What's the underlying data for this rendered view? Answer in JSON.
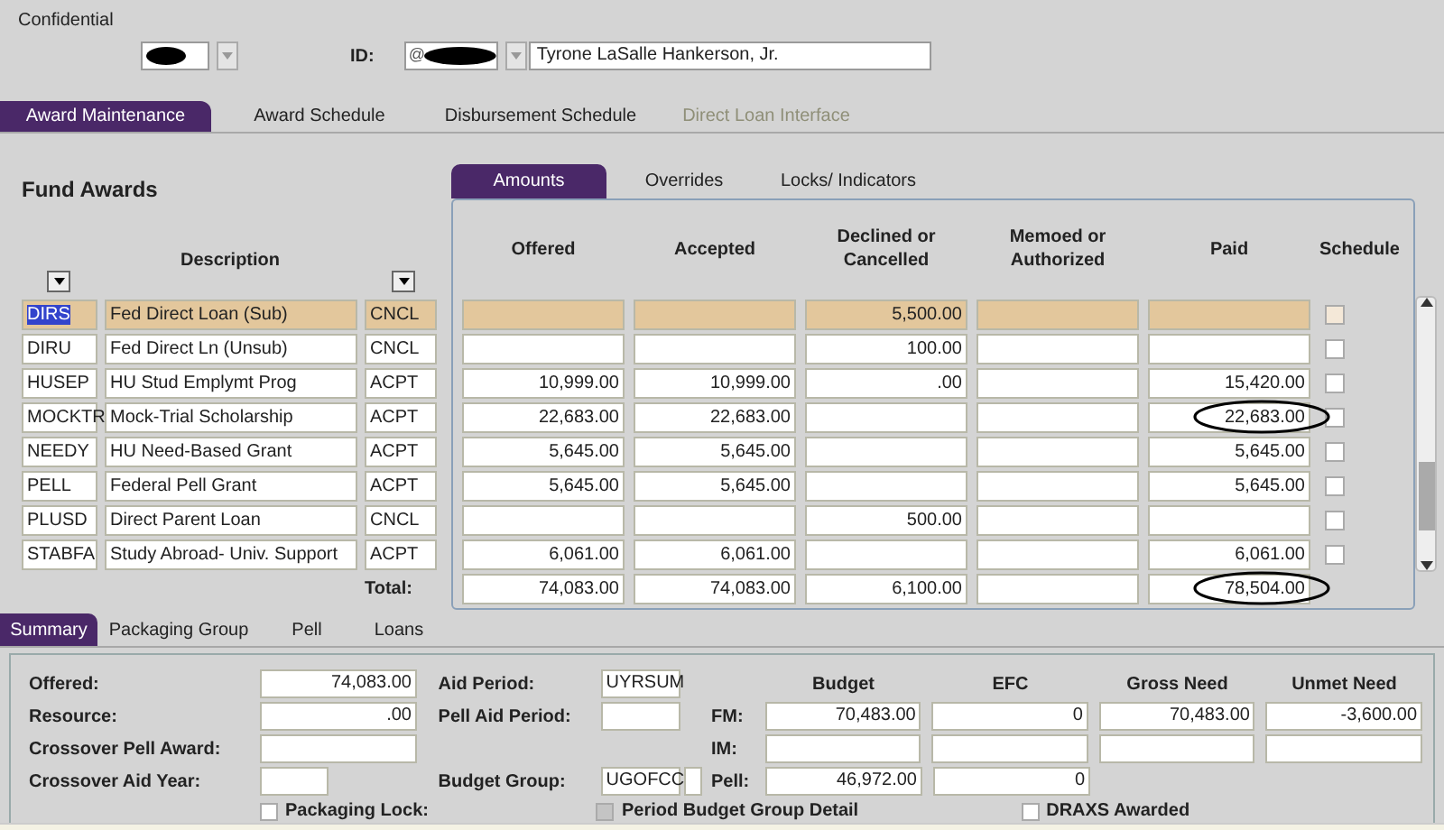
{
  "header": {
    "title": "Confidential",
    "id_label": "ID:",
    "id_prefix": "@",
    "name": "Tyrone LaSalle Hankerson, Jr."
  },
  "main_tabs": [
    {
      "label": "Award Maintenance",
      "selected": true,
      "disabled": false
    },
    {
      "label": "Award Schedule",
      "selected": false,
      "disabled": false
    },
    {
      "label": "Disbursement Schedule",
      "selected": false,
      "disabled": false
    },
    {
      "label": "Direct Loan Interface",
      "selected": false,
      "disabled": true
    }
  ],
  "fund_awards": {
    "title": "Fund Awards",
    "description_heading": "Description",
    "total_label": "Total:",
    "rows": [
      {
        "code": "DIRS",
        "description": "Fed Direct Loan (Sub)",
        "status": "CNCL",
        "declined": "5,500.00",
        "selected": true,
        "scheduled": false,
        "circled": false
      },
      {
        "code": "DIRU",
        "description": "Fed Direct Ln (Unsub)",
        "status": "CNCL",
        "declined": "100.00",
        "selected": false,
        "scheduled": false,
        "circled": false
      },
      {
        "code": "HUSEP",
        "description": "HU Stud Emplymt Prog",
        "status": "ACPT",
        "offered": "10,999.00",
        "accepted": "10,999.00",
        "declined": ".00",
        "paid": "15,420.00",
        "selected": false,
        "scheduled": false,
        "circled": false
      },
      {
        "code": "MOCKTR",
        "description": "Mock-Trial Scholarship",
        "status": "ACPT",
        "offered": "22,683.00",
        "accepted": "22,683.00",
        "paid": "22,683.00",
        "selected": false,
        "scheduled": false,
        "circled": true
      },
      {
        "code": "NEEDY",
        "description": "HU Need-Based Grant",
        "status": "ACPT",
        "offered": "5,645.00",
        "accepted": "5,645.00",
        "paid": "5,645.00",
        "selected": false,
        "scheduled": false,
        "circled": false
      },
      {
        "code": "PELL",
        "description": "Federal Pell Grant",
        "status": "ACPT",
        "offered": "5,645.00",
        "accepted": "5,645.00",
        "paid": "5,645.00",
        "selected": false,
        "scheduled": false,
        "circled": false
      },
      {
        "code": "PLUSD",
        "description": "Direct Parent Loan",
        "status": "CNCL",
        "declined": "500.00",
        "selected": false,
        "scheduled": false,
        "circled": false
      },
      {
        "code": "STABFA",
        "description": "Study Abroad- Univ. Support",
        "status": "ACPT",
        "offered": "6,061.00",
        "accepted": "6,061.00",
        "paid": "6,061.00",
        "selected": false,
        "scheduled": false,
        "circled": false
      }
    ],
    "totals": {
      "offered": "74,083.00",
      "accepted": "74,083.00",
      "declined": "6,100.00",
      "paid": "78,504.00",
      "circled": true
    }
  },
  "amount_tabs": [
    {
      "label": "Amounts",
      "selected": true
    },
    {
      "label": "Overrides",
      "selected": false
    },
    {
      "label": "Locks/ Indicators",
      "selected": false
    }
  ],
  "amount_columns": [
    "Offered",
    "Accepted",
    "Declined or Cancelled",
    "Memoed or Authorized",
    "Paid",
    "Schedule"
  ],
  "bottom_tabs": [
    {
      "label": "Summary",
      "selected": true
    },
    {
      "label": "Packaging Group",
      "selected": false
    },
    {
      "label": "Pell",
      "selected": false
    },
    {
      "label": "Loans",
      "selected": false
    }
  ],
  "summary": {
    "fields": [
      {
        "label": "Offered:",
        "value": "74,083.00"
      },
      {
        "label": "Resource:",
        "value": ".00"
      },
      {
        "label": "Crossover Pell Award:"
      },
      {
        "label": "Crossover Aid Year:"
      }
    ],
    "aid_period_label": "Aid Period:",
    "aid_period": "UYRSUM",
    "pell_aid_period_label": "Pell Aid Period:",
    "budget_group_label": "Budget Group:",
    "budget_group": "UGOFCC",
    "budget_columns": [
      "Budget",
      "EFC",
      "Gross Need",
      "Unmet Need"
    ],
    "budget_rows": [
      {
        "label": "FM:",
        "values": [
          "70,483.00",
          "0",
          "70,483.00",
          "-3,600.00"
        ]
      },
      {
        "label": "IM:",
        "values": []
      },
      {
        "label": "Pell:",
        "values": [
          "46,972.00",
          "0"
        ]
      }
    ],
    "packaging_lock_label": "Packaging Lock:",
    "period_budget_label": "Period Budget Group Detail",
    "draxs_label": "DRAXS Awarded",
    "checkboxes": [
      {
        "checked": false,
        "disabled": false
      },
      {
        "checked": false,
        "disabled": true
      },
      {
        "checked": false,
        "disabled": false
      }
    ]
  }
}
